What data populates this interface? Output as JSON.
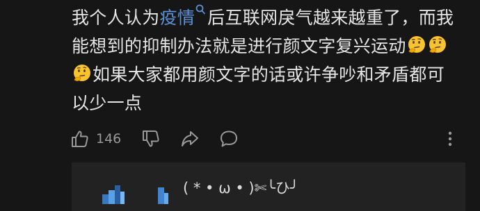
{
  "comment": {
    "line1_before": "我个人认为",
    "link_text": "疫情",
    "line1_after": "后互联网戾气越来越重了，而我",
    "line2": "能想到的抑制办法就是进行颜文字复兴运动",
    "line3": "如果大家都用颜文字的话或许争吵和矛盾都可",
    "line4": "以少一点",
    "emoji": "thinking-face"
  },
  "actions": {
    "like_count": "146"
  },
  "reply": {
    "text": "( * • ω • )✄╰ひ╯"
  },
  "colors": {
    "background": "#161616",
    "text": "#e6e6e6",
    "link": "#5b8fd6",
    "icon": "#9a9a9a",
    "reply_bg": "#222222"
  }
}
